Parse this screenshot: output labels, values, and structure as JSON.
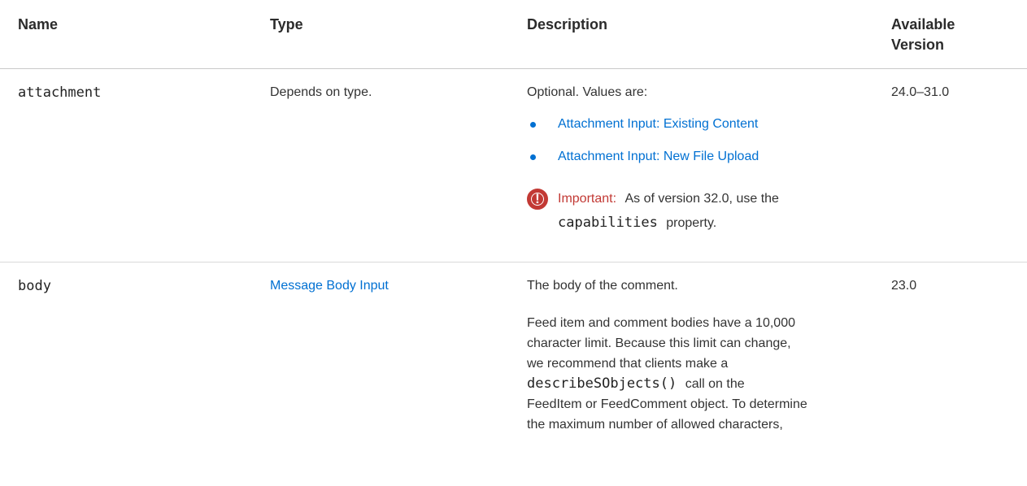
{
  "headers": {
    "name": "Name",
    "type": "Type",
    "description": "Description",
    "version_line1": "Available",
    "version_line2": "Version"
  },
  "rows": [
    {
      "name": "attachment",
      "type": "Depends on type.",
      "description_intro": "Optional. Values are:",
      "bullets": [
        "Attachment Input: Existing Content",
        "Attachment Input: New File Upload"
      ],
      "important_label": "Important:",
      "important_text": "As of version 32.0, use the",
      "important_code": "capabilities",
      "important_tail": "property.",
      "version": "24.0–31.0"
    },
    {
      "name": "body",
      "type": "Message Body Input",
      "description_intro": "The body of the comment.",
      "paragraph_lines": [
        "Feed item and comment bodies have a 10,000",
        "character limit. Because this limit can change,",
        "we recommend that clients make a"
      ],
      "code_inline": "describeSObjects()",
      "code_tail": "call on the",
      "paragraph_lines_2": [
        "FeedItem or FeedComment object. To determine",
        "the maximum number of allowed characters,"
      ],
      "version": "23.0"
    }
  ],
  "colors": {
    "link": "#0070d2",
    "important": "#c23934"
  }
}
